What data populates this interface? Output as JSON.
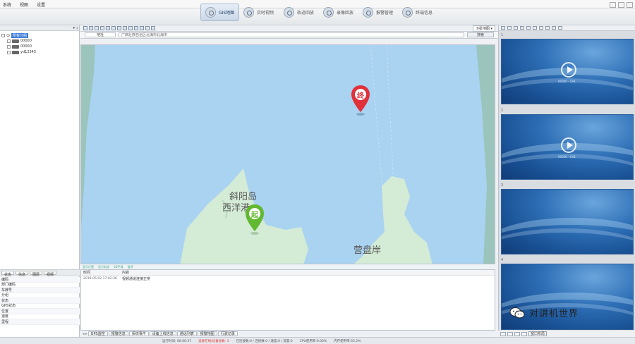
{
  "menu": [
    "系统",
    "视图",
    "设置"
  ],
  "nav": [
    {
      "label": "GIS地图",
      "active": true
    },
    {
      "label": "实时视频",
      "active": false
    },
    {
      "label": "轨迹回放",
      "active": false
    },
    {
      "label": "录像回放",
      "active": false
    },
    {
      "label": "报警管理",
      "active": false
    },
    {
      "label": "终端信息",
      "active": false
    }
  ],
  "tree": [
    {
      "label": "所有分组",
      "selected": true,
      "indent": 0
    },
    {
      "label": "00000",
      "selected": false,
      "indent": 1
    },
    {
      "label": "00000",
      "selected": false,
      "indent": 1
    },
    {
      "label": "yd12345",
      "selected": false,
      "indent": 1
    }
  ],
  "left_tabs": [
    "状态",
    "信息",
    "图层",
    "视频"
  ],
  "props": [
    "编码",
    "部门编码",
    "车牌号",
    "分组",
    "状态",
    "GPS状态",
    "位置",
    "速度",
    "里程"
  ],
  "addr": {
    "label": "地址",
    "value": "广西壮族自治区北海市北海市",
    "search": "搜索"
  },
  "map_labels": {
    "a": "斜阳岛",
    "b": "西洋港",
    "c": "营盘岸"
  },
  "pins": {
    "end": "终",
    "start": "起"
  },
  "map_status": [
    "显示位置",
    "显示轨迹",
    "3D平滑",
    "暂停"
  ],
  "events": {
    "head": [
      "时间",
      "内容"
    ],
    "rows": [
      {
        "time": "2018-05-02 17:02:36",
        "content": "视频通道连接正常"
      }
    ]
  },
  "bottom_tabs": [
    "GPS监控",
    "报警信息",
    "系统事件",
    "设备上线信息",
    "通话列表",
    "报警地图",
    "行驶记录"
  ],
  "map_type": "卫星地图",
  "video_nums": [
    "1",
    "2",
    "3",
    "4"
  ],
  "video_caption": "00000 - CH1",
  "right_bottom_label": "窗口布局",
  "status": {
    "time": "运行时间: 00:00:37",
    "alert": "设备在线/设备总数: 3",
    "stat1": "已连接数:0 / 连接数:0 / 速度:0 / 流量:0",
    "stat2": "CPU使用率:0.00%",
    "stat3": "内存使用率:55.2%"
  },
  "watermark": "对讲机世界",
  "colors": {
    "accent": "#3b7dd8",
    "water": "#a9d3f1",
    "land": "#d4ebd6",
    "end_pin": "#e0313b",
    "start_pin": "#62b830"
  }
}
